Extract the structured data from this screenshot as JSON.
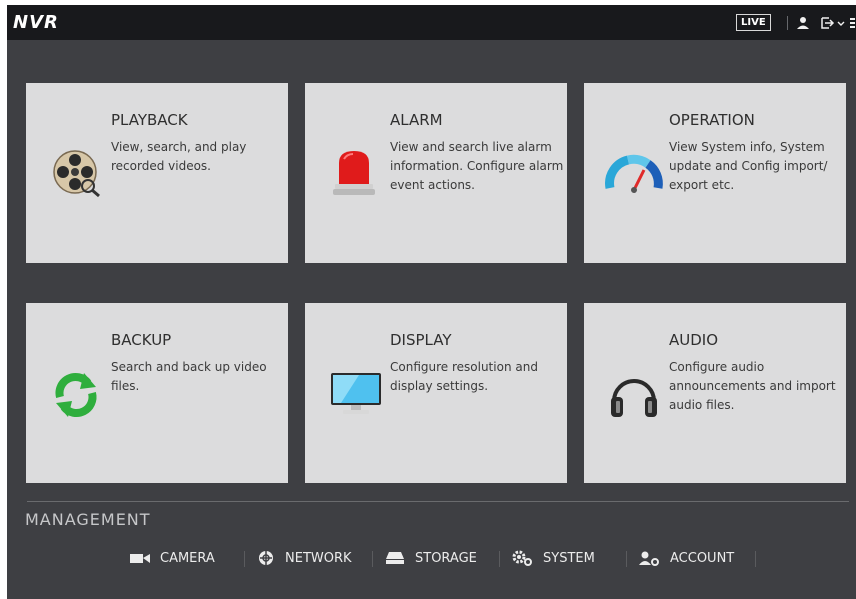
{
  "topbar": {
    "brand": "NVR",
    "live_label": "LIVE",
    "icons": [
      "user-icon",
      "logout-icon",
      "more-icon"
    ]
  },
  "cards": [
    {
      "id": "playback",
      "title": "PLAYBACK",
      "description": "View, search, and play recorded videos.",
      "icon": "film-reel-icon"
    },
    {
      "id": "alarm",
      "title": "ALARM",
      "description": "View and search live alarm information. Configure alarm event actions.",
      "icon": "alarm-light-icon"
    },
    {
      "id": "operation",
      "title": "OPERATION",
      "description": "View System info, System update and Config import/ export etc.",
      "icon": "gauge-icon"
    },
    {
      "id": "backup",
      "title": "BACKUP",
      "description": "Search and back up video files.",
      "icon": "sync-icon"
    },
    {
      "id": "display",
      "title": "DISPLAY",
      "description": "Configure resolution and display settings.",
      "icon": "monitor-icon"
    },
    {
      "id": "audio",
      "title": "AUDIO",
      "description": "Configure audio announcements and import audio files.",
      "icon": "headphones-icon"
    }
  ],
  "management": {
    "title": "MANAGEMENT",
    "items": [
      {
        "label": "CAMERA",
        "icon": "camera-icon"
      },
      {
        "label": "NETWORK",
        "icon": "network-icon"
      },
      {
        "label": "STORAGE",
        "icon": "storage-icon"
      },
      {
        "label": "SYSTEM",
        "icon": "system-gear-icon"
      },
      {
        "label": "ACCOUNT",
        "icon": "account-icon"
      }
    ]
  },
  "colors": {
    "screen_bg": "#3e3f43",
    "topbar_bg": "#18191c",
    "card_bg": "#dcdcdd",
    "text_light": "#ececec"
  }
}
